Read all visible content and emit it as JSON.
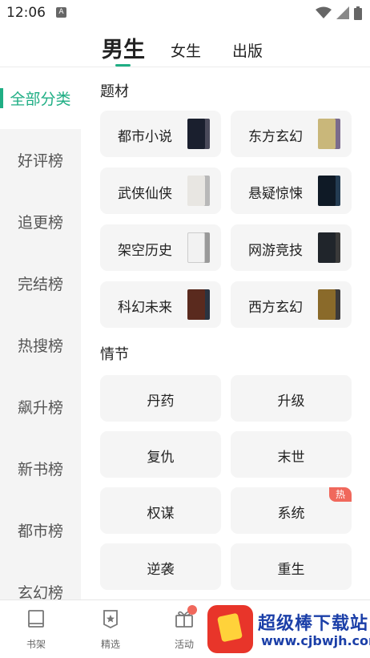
{
  "status_bar": {
    "time": "12:06",
    "notification_glyph": "A"
  },
  "top_tabs": {
    "male": "男生",
    "female": "女生",
    "publish": "出版"
  },
  "sidebar": {
    "items": [
      {
        "label": "全部分类"
      },
      {
        "label": "好评榜"
      },
      {
        "label": "追更榜"
      },
      {
        "label": "完结榜"
      },
      {
        "label": "热搜榜"
      },
      {
        "label": "飙升榜"
      },
      {
        "label": "新书榜"
      },
      {
        "label": "都市榜"
      },
      {
        "label": "玄幻榜"
      }
    ]
  },
  "themes": {
    "title": "题材",
    "items": [
      {
        "label": "都市小说",
        "cover_colors": [
          "#4a4a5a",
          "#1a1f2e"
        ]
      },
      {
        "label": "东方玄幻",
        "cover_colors": [
          "#7a6b8c",
          "#c9b77a"
        ]
      },
      {
        "label": "武侠仙侠",
        "cover_colors": [
          "#b8b8b8",
          "#e8e6e2"
        ]
      },
      {
        "label": "悬疑惊悚",
        "cover_colors": [
          "#243c52",
          "#0f1a26"
        ]
      },
      {
        "label": "架空历史",
        "cover_colors": [
          "#9a9a9a",
          "#f2f2f2"
        ]
      },
      {
        "label": "网游竞技",
        "cover_colors": [
          "#3a3a3a",
          "#20252b"
        ]
      },
      {
        "label": "科幻未来",
        "cover_colors": [
          "#2b3340",
          "#5a2a1e"
        ]
      },
      {
        "label": "西方玄幻",
        "cover_colors": [
          "#3c3a3a",
          "#8a6a2a"
        ]
      }
    ]
  },
  "plots": {
    "title": "情节",
    "items": [
      {
        "label": "丹药"
      },
      {
        "label": "升级"
      },
      {
        "label": "复仇"
      },
      {
        "label": "末世"
      },
      {
        "label": "权谋"
      },
      {
        "label": "系统",
        "badge": "热"
      },
      {
        "label": "逆袭"
      },
      {
        "label": "重生"
      }
    ]
  },
  "bottom_nav": {
    "bookshelf": "书架",
    "featured": "精选",
    "activity": "活动"
  },
  "watermark": {
    "title": "超级棒下载站",
    "url": "www.cjbwjh.com"
  },
  "colors": {
    "accent": "#1fae84",
    "hot": "#f0685c",
    "card_bg": "#f5f5f5",
    "sidebar_bg": "#f4f4f4"
  }
}
